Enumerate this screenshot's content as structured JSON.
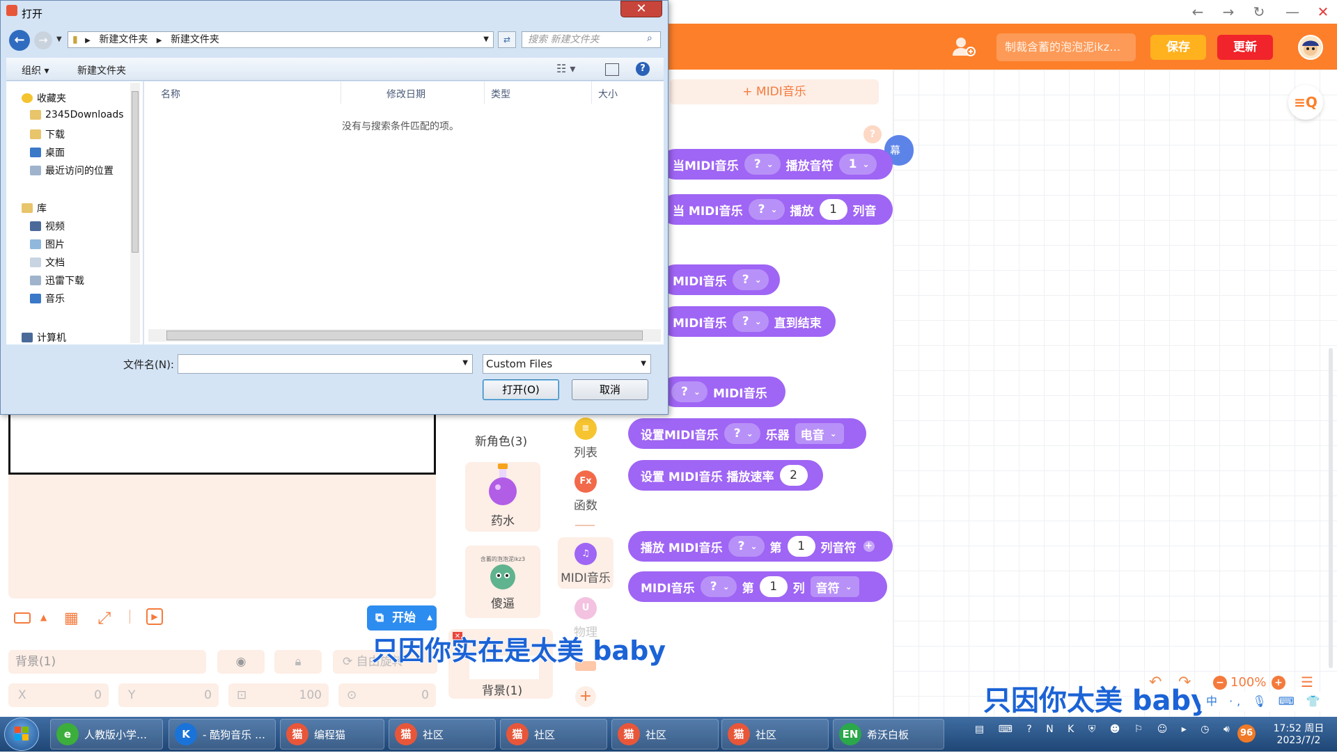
{
  "app": {
    "project_title": "制裁含蓄的泡泡泥ikz…",
    "save_label": "保存",
    "update_label": "更新",
    "add_midi_label": "+ MIDI音乐",
    "help_badge": "?",
    "brand_color": "#fd7f2a",
    "block_color": "#9f65f4"
  },
  "blocks": {
    "b1_a": "当MIDI音乐",
    "b1_dd": "?",
    "b1_b": "播放音符",
    "b1_num": "1",
    "b2_a": "当 MIDI音乐",
    "b2_dd": "?",
    "b2_b": "播放",
    "b2_num": "1",
    "b2_c": "列音",
    "b3_a": "MIDI音乐",
    "b3_dd": "?",
    "b4_a": "MIDI音乐",
    "b4_dd": "?",
    "b4_b": "直到结束",
    "b5_dd": "?",
    "b5_b": "MIDI音乐",
    "b6_a": "设置MIDI音乐",
    "b6_dd": "?",
    "b6_b": "乐器",
    "b6_dd2": "电音",
    "b7_a": "设置 MIDI音乐 播放速率",
    "b7_num": "2",
    "b8_a": "播放 MIDI音乐",
    "b8_dd": "?",
    "b8_b": "第",
    "b8_num": "1",
    "b8_c": "列音符",
    "b9_a": "MIDI音乐",
    "b9_dd": "?",
    "b9_b": "第",
    "b9_num": "1",
    "b9_c": "列",
    "b9_dd2": "音符",
    "edge_block": "幕"
  },
  "categories": {
    "list": "列表",
    "func": "函数",
    "func_icon": "Fx",
    "midi": "MIDI音乐",
    "physics": "物理"
  },
  "sprites": {
    "new_role": "新角色(3)",
    "potion": "药水",
    "silly": "傻逼",
    "silly_caption": "含蓄的泡泡泥ikz3",
    "background": "背景(1)"
  },
  "stage": {
    "start_label": "开始",
    "bg_field": "背景(1)",
    "x_label": "X",
    "x_value": "0",
    "y_label": "Y",
    "y_value": "0",
    "size_value": "100",
    "rot_value": "0",
    "auto_label": "自由旋转"
  },
  "zoom": {
    "level": "100%"
  },
  "subtitles": {
    "line1": "只因你实在是太美  baby",
    "line2": "只因你太美  baby"
  },
  "dialog": {
    "title": "打开",
    "close": "✕",
    "path_1": "新建文件夹",
    "path_2": "新建文件夹",
    "search_placeholder": "搜索 新建文件夹",
    "organize": "组织 ▾",
    "new_folder": "新建文件夹",
    "nav": {
      "favorites": "收藏夹",
      "downloads_2345": "2345Downloads",
      "downloads": "下载",
      "desktop": "桌面",
      "recent": "最近访问的位置",
      "library": "库",
      "video": "视频",
      "pictures": "图片",
      "documents": "文档",
      "thunder": "迅雷下载",
      "music": "音乐",
      "computer": "计算机"
    },
    "col_name": "名称",
    "col_date": "修改日期",
    "col_type": "类型",
    "col_size": "大小",
    "empty_msg": "没有与搜索条件匹配的项。",
    "filename_label": "文件名(N):",
    "filename_value": "",
    "filter_value": "Custom Files",
    "open_btn": "打开(O)",
    "cancel_btn": "取消"
  },
  "taskbar": {
    "items": [
      {
        "label": "人教版小学…",
        "icon": "e",
        "color": "#3cae3c"
      },
      {
        "label": "- 酷狗音乐 …",
        "icon": "K",
        "color": "#1a73d9"
      },
      {
        "label": "编程猫",
        "icon": "猫",
        "color": "#e8563a"
      },
      {
        "label": "社区",
        "icon": "猫",
        "color": "#e8563a"
      },
      {
        "label": "社区",
        "icon": "猫",
        "color": "#e8563a"
      },
      {
        "label": "社区",
        "icon": "猫",
        "color": "#e8563a"
      },
      {
        "label": "社区",
        "icon": "猫",
        "color": "#e8563a"
      },
      {
        "label": "希沃白板",
        "icon": "EN",
        "color": "#2aa84a"
      }
    ],
    "badge": "96",
    "time": "17:52 周日",
    "date": "2023/7/2"
  }
}
